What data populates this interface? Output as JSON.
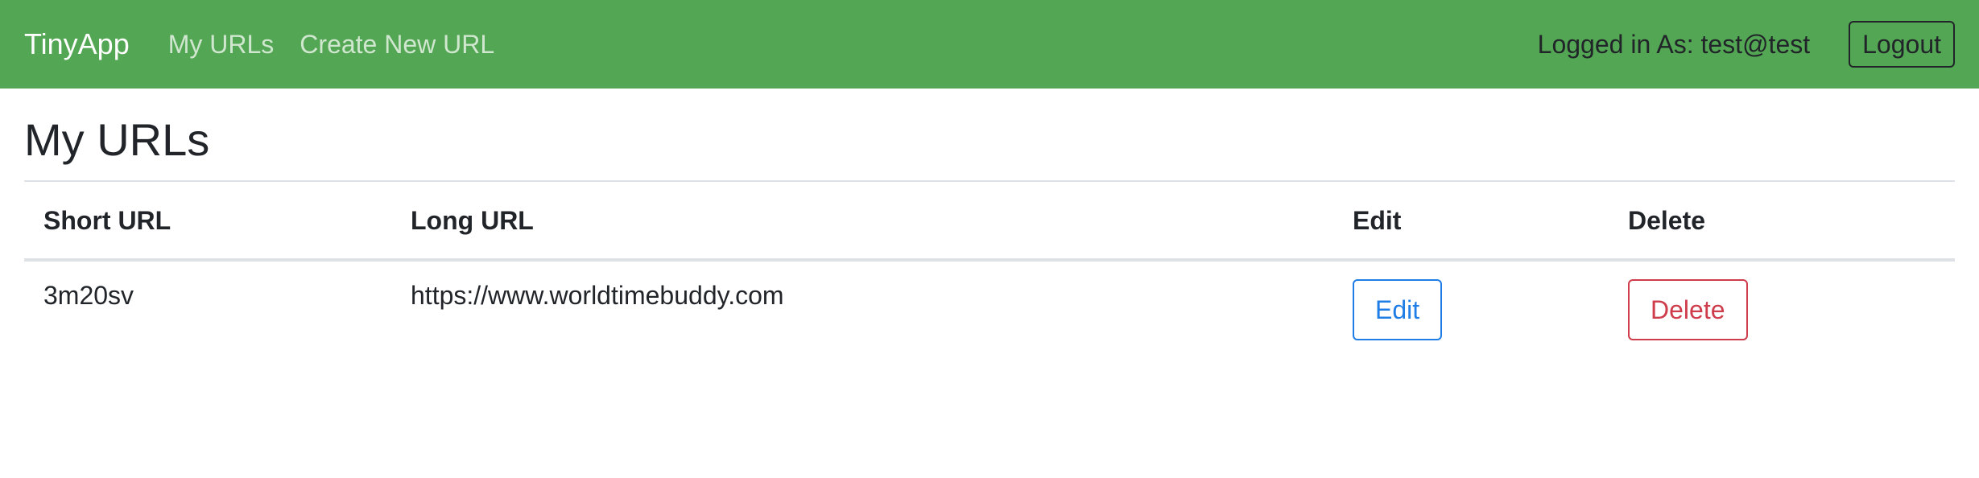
{
  "navbar": {
    "brand": "TinyApp",
    "links": [
      "My URLs",
      "Create New URL"
    ],
    "logged_in_text": "Logged in As: test@test",
    "logout_label": "Logout",
    "background_color": "#53a653"
  },
  "main": {
    "title": "My URLs",
    "table": {
      "headers": [
        "Short URL",
        "Long URL",
        "Edit",
        "Delete"
      ],
      "rows": [
        {
          "short_url": "3m20sv",
          "long_url": "https://www.worldtimebuddy.com",
          "edit_label": "Edit",
          "delete_label": "Delete"
        }
      ]
    }
  },
  "colors": {
    "edit_accent": "#1f7de6",
    "delete_accent": "#cf3c4b"
  }
}
